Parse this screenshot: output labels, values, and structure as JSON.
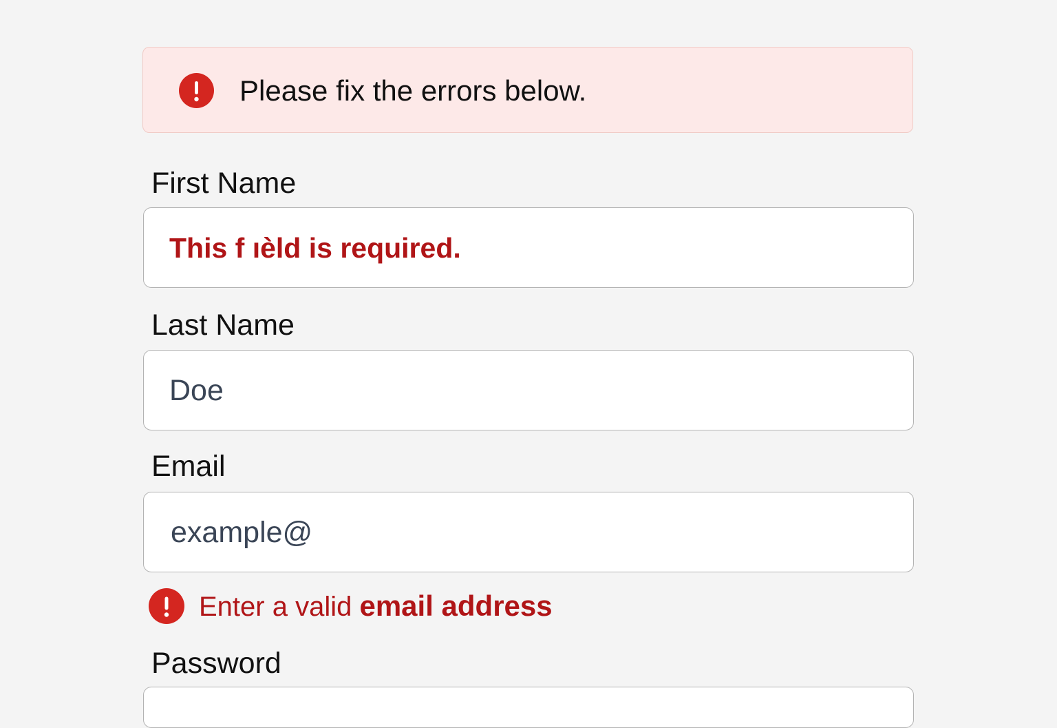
{
  "alert": {
    "icon": "error-circle-icon",
    "message": "Please fix the errors below.",
    "background": "#fde9e8",
    "icon_color": "#d42620"
  },
  "form": {
    "first_name": {
      "label": "First Name",
      "value": "This f ıèld is required."
    },
    "last_name": {
      "label": "Last Name",
      "value": "Doe"
    },
    "email": {
      "label": "Email",
      "value": "example@",
      "error_icon": "error-circle-icon",
      "error_prefix": "Enter a valid ",
      "error_emphasis": "email address"
    },
    "password": {
      "label": "Password",
      "value": ""
    }
  },
  "colors": {
    "error_text": "#b01517",
    "input_text": "#3a4556",
    "label_text": "#111111",
    "page_background": "#f4f4f4"
  }
}
